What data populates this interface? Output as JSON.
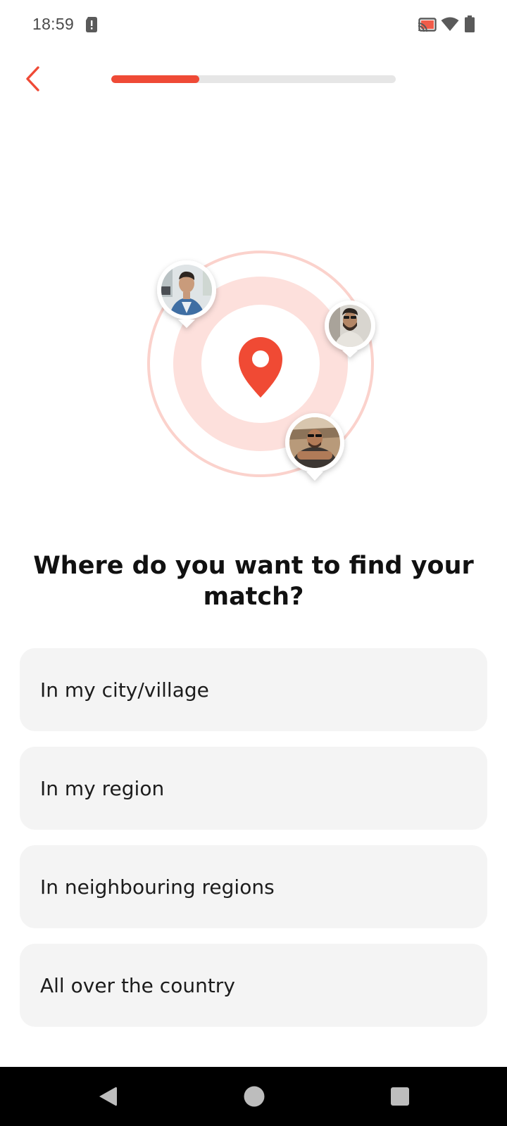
{
  "status_bar": {
    "time": "18:59",
    "icons": [
      "sim-alert-icon",
      "cast-icon",
      "wifi-icon",
      "battery-icon"
    ]
  },
  "header": {
    "back_icon": "chevron-left-icon",
    "progress": 0.31
  },
  "illustration": {
    "center_icon": "location-pin-icon",
    "avatars": [
      "avatar-man-blue-shirt",
      "avatar-man-sunglasses-beard",
      "avatar-man-sunglasses-arms-crossed"
    ]
  },
  "question": {
    "title": "Where do you want to find your match?"
  },
  "options": [
    {
      "label": "In my city/village"
    },
    {
      "label": "In my region"
    },
    {
      "label": "In neighbouring regions"
    },
    {
      "label": "All over the country"
    }
  ],
  "nav_bar": {
    "icons": [
      "back-triangle-icon",
      "home-circle-icon",
      "recents-square-icon"
    ]
  },
  "colors": {
    "accent": "#ef4a36",
    "ring_light": "#fde1dd",
    "ring_mid": "#fbcdc6",
    "card_bg": "#f4f4f4",
    "progress_track": "#e6e6e6"
  }
}
